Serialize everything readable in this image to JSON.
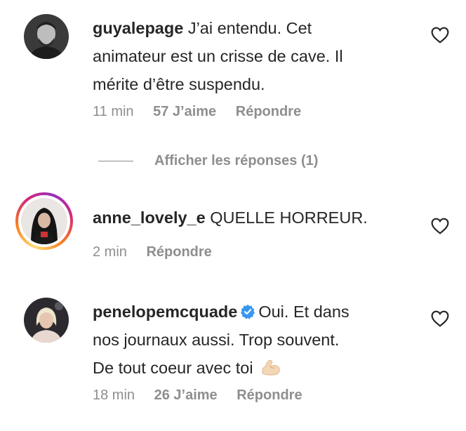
{
  "comments": [
    {
      "username": "guyalepage",
      "text_line1": " J’ai entendu. Cet",
      "text_line2": "animateur est un crisse de cave. Il",
      "text_line3": "mérite d’être suspendu.",
      "time": "11 min",
      "likes": "57 J’aime",
      "reply": "Répondre",
      "verified": false,
      "story_ring": false
    },
    {
      "username": "anne_lovely_e",
      "text_line1": " QUELLE HORREUR.",
      "time": "2 min",
      "reply": "Répondre",
      "verified": false,
      "story_ring": true
    },
    {
      "username": "penelopemcquade",
      "text_line1": "Oui. Et dans",
      "text_line2": "nos journaux aussi. Trop souvent.",
      "text_line3": "De tout coeur avec toi",
      "emoji": "flexed-biceps-emoji",
      "time": "18 min",
      "likes": "26 J’aime",
      "reply": "Répondre",
      "verified": true,
      "story_ring": false
    }
  ],
  "view_replies": "Afficher les réponses (1)",
  "colors": {
    "text": "#262626",
    "secondary": "#8e8e8e",
    "verified": "#3897f0"
  }
}
